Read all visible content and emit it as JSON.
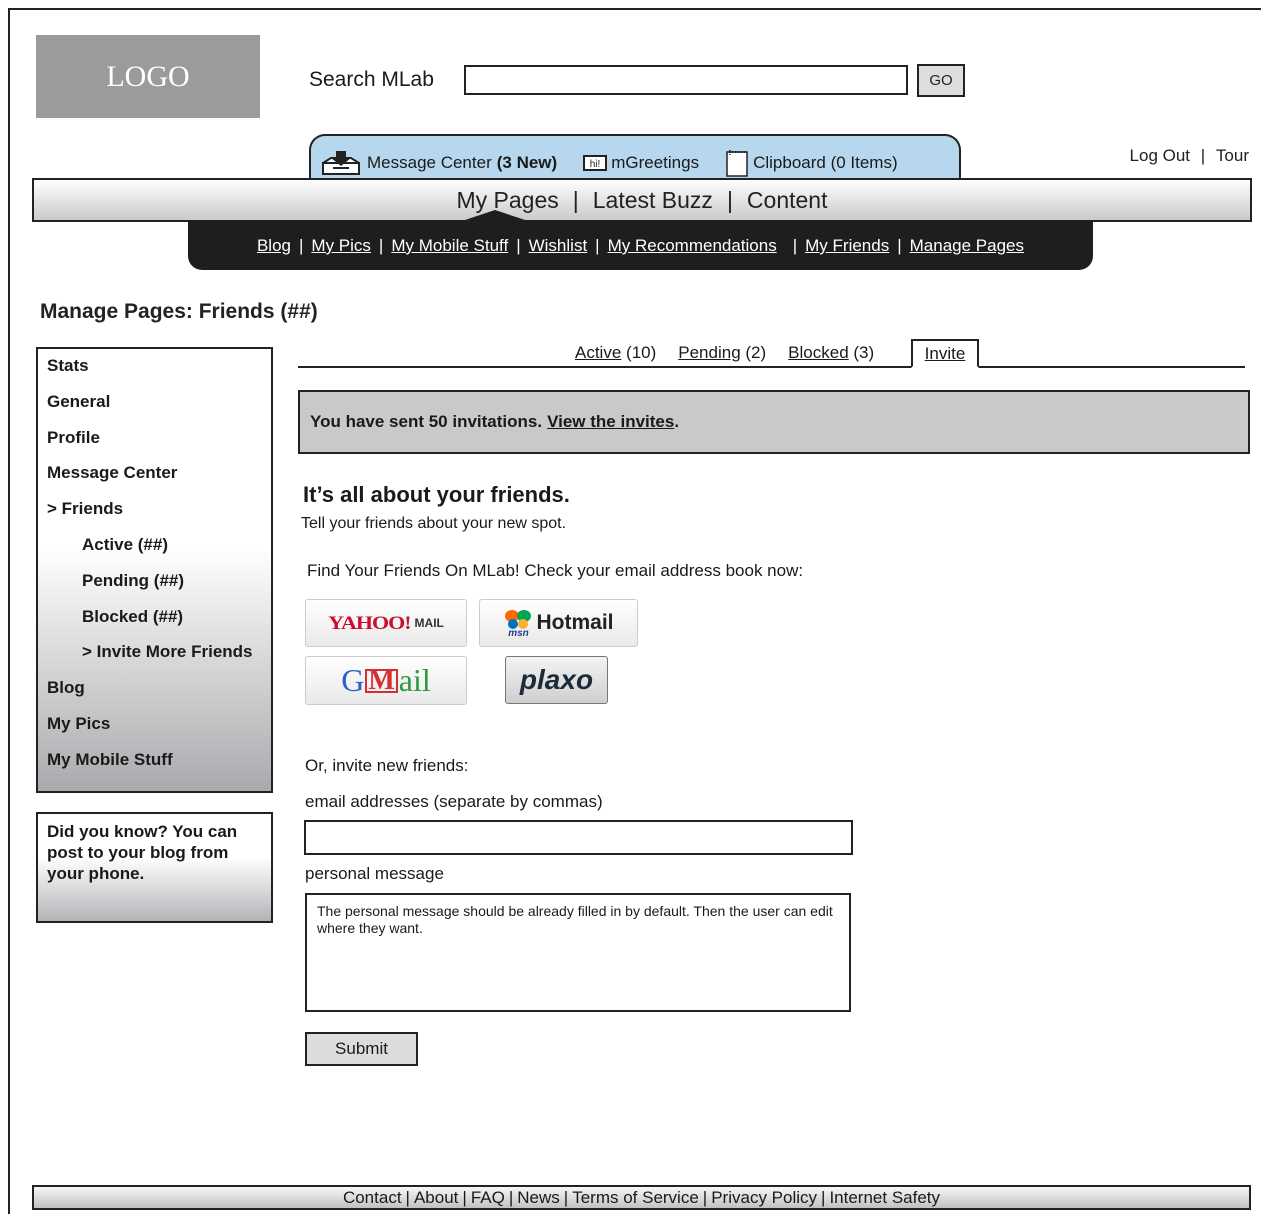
{
  "logo": "LOGO",
  "search": {
    "label": "Search MLab",
    "value": "",
    "go_label": "GO"
  },
  "utility_tabs": {
    "message_center": "Message Center",
    "message_center_new": "(3 New)",
    "mgreetings_icon_text": "hi!",
    "mgreetings": "mGreetings",
    "clipboard": "Clipboard (0 Items)"
  },
  "account_links": {
    "logout": "Log Out",
    "separator": "|",
    "tour": "Tour"
  },
  "main_nav": {
    "items": [
      "My Pages",
      "Latest Buzz",
      "Content"
    ],
    "separator": "|"
  },
  "sub_nav": {
    "items": [
      "Blog",
      "My Pics",
      "My Mobile Stuff",
      "Wishlist",
      "My Recommendations",
      "My Friends",
      "Manage Pages"
    ],
    "separator": "|"
  },
  "page_title": "Manage Pages: Friends (##)",
  "sidebar": {
    "items": [
      "Stats",
      "General",
      "Profile",
      "Message Center",
      "> Friends",
      "Active (##)",
      "Pending (##)",
      "Blocked (##)",
      "> Invite More Friends",
      "Blog",
      "My Pics",
      "My Mobile Stuff"
    ]
  },
  "tip": "Did you know? You can post to your blog from your phone.",
  "tabs": {
    "active_label": "Active",
    "active_count": "(10)",
    "pending_label": "Pending",
    "pending_count": "(2)",
    "blocked_label": "Blocked",
    "blocked_count": "(3)",
    "invite_label": "Invite"
  },
  "notice": {
    "text": "You have sent 50 invitations.",
    "link": "View the invites",
    "end": "."
  },
  "heading": "It’s all about your friends.",
  "intro": "Tell your friends about your new spot.",
  "find_friends": "Find Your Friends On MLab! Check your email address book now:",
  "providers": {
    "yahoo": "YAHOO!",
    "yahoo_mail": "MAIL",
    "hotmail_msn": "msn",
    "hotmail": "Hotmail",
    "gmail_g": "G",
    "gmail_m": "M",
    "gmail_ail": "ail",
    "plaxo": "plaxo"
  },
  "or_invite": "Or, invite new friends:",
  "email_label": "email addresses (separate by commas)",
  "email_value": "",
  "message_label": "personal message",
  "message_value": "The personal message should be already filled in by default. Then the user can edit where they want.",
  "submit_label": "Submit",
  "footer": {
    "items": [
      "Contact",
      "About",
      "FAQ",
      "News",
      "Terms of Service",
      "Privacy Policy",
      "Internet Safety"
    ],
    "separator": "|"
  }
}
